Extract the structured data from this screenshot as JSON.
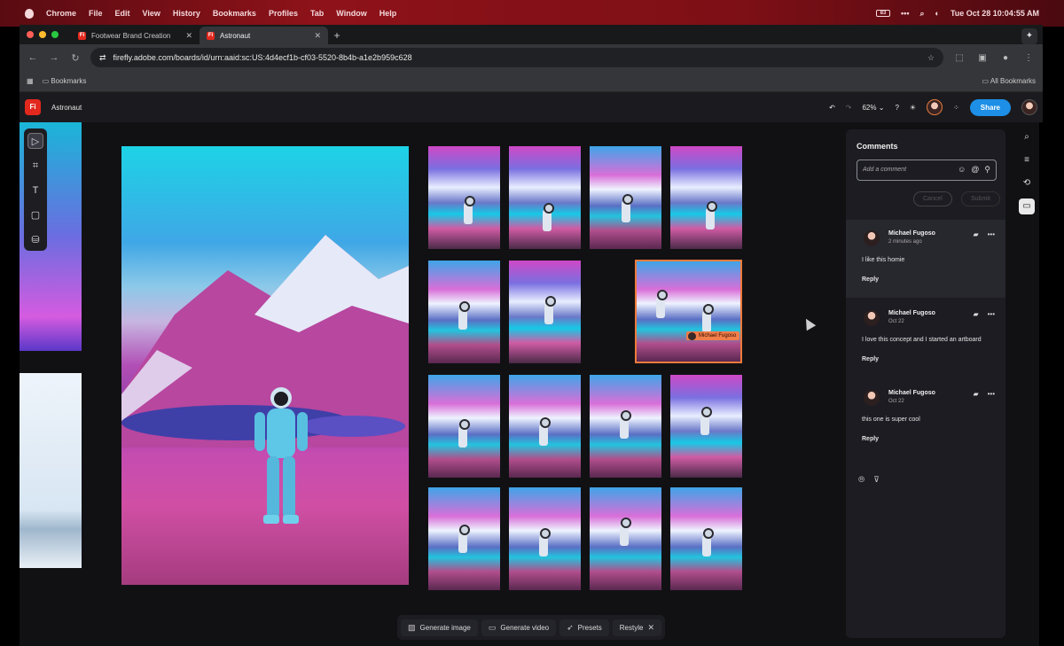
{
  "menubar": {
    "app": "Chrome",
    "items": [
      "File",
      "Edit",
      "View",
      "History",
      "Bookmarks",
      "Profiles",
      "Tab",
      "Window",
      "Help"
    ],
    "clock": "Tue Oct 28  10:04:55 AM",
    "battery": "83"
  },
  "tabs": [
    {
      "label": "Footwear Brand Creation",
      "active": false
    },
    {
      "label": "Astronaut",
      "active": true
    }
  ],
  "address": {
    "url": "firefly.adobe.com/boards/id/urn:aaid:sc:US:4d4ecf1b-cf03-5520-8b4b-a1e2b959c628"
  },
  "bookmarks": {
    "folder": "Bookmarks",
    "all": "All Bookmarks"
  },
  "app": {
    "logo": "Fi",
    "project": "Astronaut",
    "zoom": "62%",
    "share": "Share"
  },
  "canvas": {
    "tag": "Michael Fugoso"
  },
  "bottombar": {
    "generate_image": "Generate image",
    "generate_video": "Generate video",
    "presets": "Presets",
    "restyle": "Restyle"
  },
  "comments": {
    "title": "Comments",
    "placeholder": "Add a comment",
    "cancel": "Cancel",
    "submit": "Submit",
    "items": [
      {
        "author": "Michael Fugoso",
        "time": "2 minutes ago",
        "text": "I like this homie",
        "reply": "Reply"
      },
      {
        "author": "Michael Fugoso",
        "time": "Oct 22",
        "text": "I love this concept and I started an artboard",
        "reply": "Reply"
      },
      {
        "author": "Michael Fugoso",
        "time": "Oct 22",
        "text": "this one is super cool",
        "reply": "Reply"
      }
    ]
  },
  "icons": [
    "apple-icon",
    "back-icon",
    "forward-icon",
    "reload-icon",
    "star-icon",
    "undo-icon",
    "redo-icon",
    "help-icon",
    "lightbulb-icon",
    "apps-icon",
    "search-icon",
    "filter-icon",
    "history-icon",
    "comment-icon",
    "emoji-icon",
    "mention-icon",
    "pin-icon",
    "image-icon",
    "video-icon",
    "rocket-icon",
    "close-icon"
  ]
}
